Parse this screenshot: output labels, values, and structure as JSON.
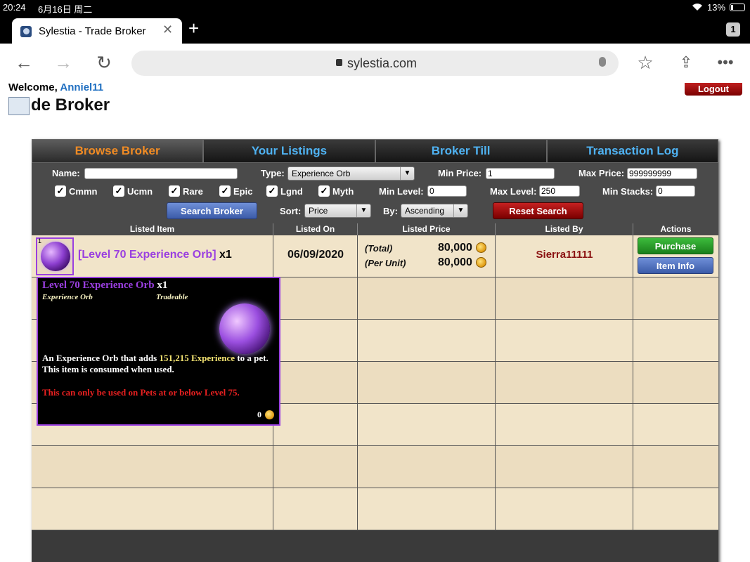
{
  "status_bar": {
    "time": "20:24",
    "date": "6月16日 周二",
    "battery": "13%"
  },
  "browser": {
    "tab_title": "Sylestia - Trade Broker",
    "tab_count": "1",
    "url": "sylestia.com"
  },
  "header": {
    "welcome": "Welcome,",
    "username": "Anniel11",
    "logout": "Logout",
    "page_title": "de Broker"
  },
  "tabs": [
    "Browse Broker",
    "Your Listings",
    "Broker Till",
    "Transaction Log"
  ],
  "filters": {
    "name_label": "Name:",
    "name_value": "",
    "type_label": "Type:",
    "type_value": "Experience Orb",
    "min_price_label": "Min Price:",
    "min_price_value": "1",
    "max_price_label": "Max Price:",
    "max_price_value": "999999999",
    "rarities": [
      "Cmmn",
      "Ucmn",
      "Rare",
      "Epic",
      "Lgnd",
      "Myth"
    ],
    "min_level_label": "Min Level:",
    "min_level_value": "0",
    "max_level_label": "Max Level:",
    "max_level_value": "250",
    "min_stacks_label": "Min Stacks:",
    "min_stacks_value": "0",
    "search_button": "Search Broker",
    "sort_label": "Sort:",
    "sort_value": "Price",
    "by_label": "By:",
    "by_value": "Ascending",
    "reset_button": "Reset Search"
  },
  "table": {
    "headers": [
      "Listed Item",
      "Listed On",
      "Listed Price",
      "Listed By",
      "Actions"
    ],
    "listing": {
      "stack": "1",
      "item_name": "[Level 70 Experience Orb]",
      "qty": "x1",
      "listed_on": "06/09/2020",
      "total_label": "(Total)",
      "total_price": "80,000",
      "unit_label": "(Per Unit)",
      "unit_price": "80,000",
      "seller": "Sierra11111",
      "purchase": "Purchase",
      "item_info": "Item Info"
    }
  },
  "tooltip": {
    "name": "Level 70 Experience Orb",
    "qty": "x1",
    "type": "Experience Orb",
    "tradeable": "Tradeable",
    "desc_pre": "An Experience Orb that adds ",
    "desc_hl": "151,215 Experience",
    "desc_post": " to a pet. This item is consumed when used.",
    "warning": "This can only be used on Pets at or below Level 75.",
    "value": "0"
  }
}
